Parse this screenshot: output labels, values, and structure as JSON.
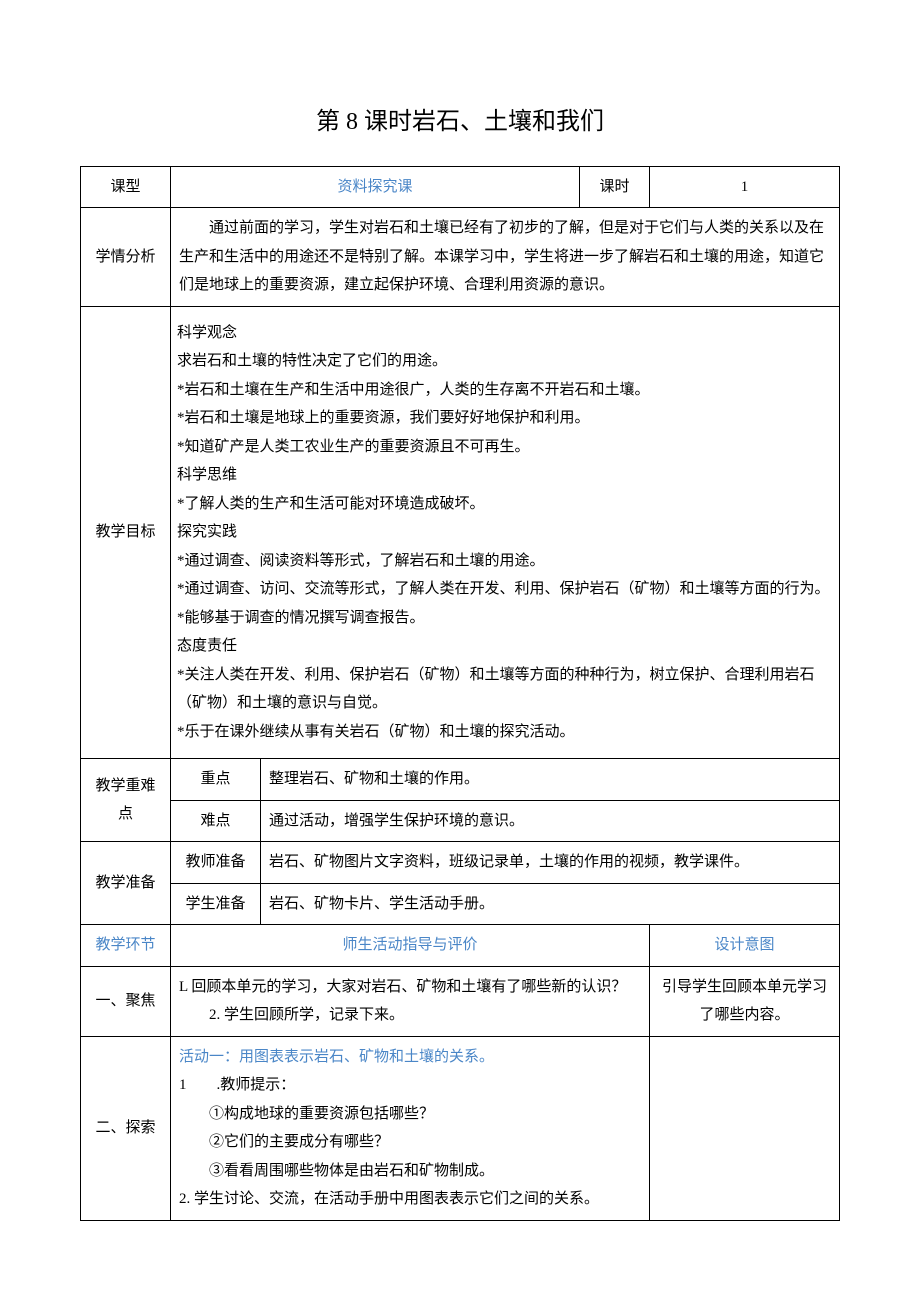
{
  "title": "第 8 课时岩石、土壤和我们",
  "row1": {
    "label_type": "课型",
    "type_value": "资料探究课",
    "label_period": "课时",
    "period_value": "1"
  },
  "analysis": {
    "label": "学情分析",
    "text": "通过前面的学习，学生对岩石和土壤已经有了初步的了解，但是对于它们与人类的关系以及在生产和生活中的用途还不是特别了解。本课学习中，学生将进一步了解岩石和土壤的用途，知道它们是地球上的重要资源，建立起保护环境、合理利用资源的意识。"
  },
  "goals": {
    "label": "教学目标",
    "g1_head": "科学观念",
    "g1_1": "求岩石和土壤的特性决定了它们的用途。",
    "g1_2": "*岩石和土壤在生产和生活中用途很广，人类的生存离不开岩石和土壤。",
    "g1_3": "*岩石和土壤是地球上的重要资源，我们要好好地保护和利用。",
    "g1_4": "*知道矿产是人类工农业生产的重要资源且不可再生。",
    "g2_head": "科学思维",
    "g2_1": "*了解人类的生产和生活可能对环境造成破坏。",
    "g3_head": "探究实践",
    "g3_1": "*通过调查、阅读资料等形式，了解岩石和土壤的用途。",
    "g3_2": "*通过调查、访问、交流等形式，了解人类在开发、利用、保护岩石（矿物）和土壤等方面的行为。",
    "g3_3": "*能够基于调查的情况撰写调查报告。",
    "g4_head": "态度责任",
    "g4_1": "*关注人类在开发、利用、保护岩石（矿物）和土壤等方面的种种行为，树立保护、合理利用岩石（矿物）和土壤的意识与自觉。",
    "g4_2": "*乐于在课外继续从事有关岩石（矿物）和土壤的探究活动。"
  },
  "key": {
    "label": "教学重难点",
    "key_label": "重点",
    "key_text": "整理岩石、矿物和土壤的作用。",
    "diff_label": "难点",
    "diff_text": "通过活动，增强学生保护环境的意识。"
  },
  "prep": {
    "label": "教学准备",
    "teacher_label": "教师准备",
    "teacher_text": "岩石、矿物图片文字资料，班级记录单，土壤的作用的视频，教学课件。",
    "student_label": "学生准备",
    "student_text": "岩石、矿物卡片、学生活动手册。"
  },
  "header2": {
    "col1": "教学环节",
    "col2": "师生活动指导与评价",
    "col3": "设计意图"
  },
  "focus": {
    "label": "一、聚焦",
    "line1": "L 回顾本单元的学习，大家对岩石、矿物和土壤有了哪些新的认识？",
    "line2": "2. 学生回顾所学，记录下来。",
    "design": "引导学生回顾本单元学习了哪些内容。"
  },
  "explore": {
    "label": "二、探索",
    "act_title": "活动一：用图表表示岩石、矿物和土壤的关系。",
    "line1": "1　　.教师提示：",
    "q1": "①构成地球的重要资源包括哪些？",
    "q2": "②它们的主要成分有哪些？",
    "q3": "③看看周围哪些物体是由岩石和矿物制成。",
    "line2": "2. 学生讨论、交流，在活动手册中用图表表示它们之间的关系。",
    "design": ""
  }
}
